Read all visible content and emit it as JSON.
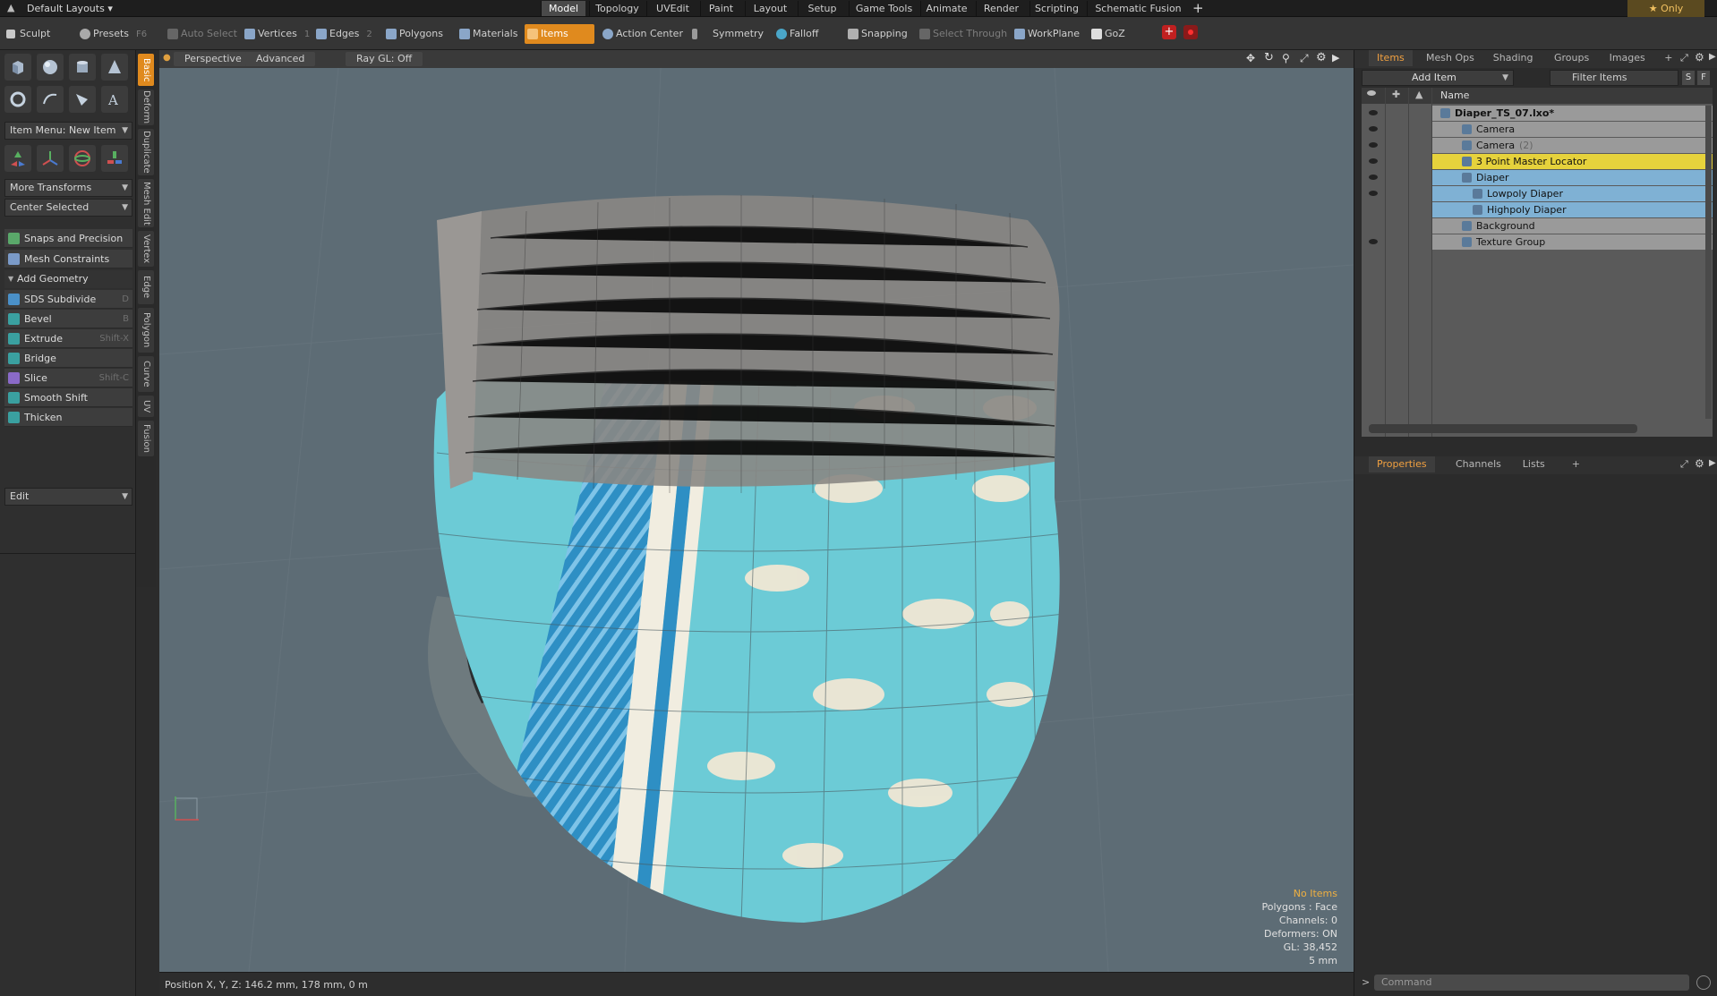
{
  "menubar": {
    "layouts": "Default Layouts",
    "tabs": [
      "Model",
      "Topology",
      "UVEdit",
      "Paint",
      "Layout",
      "Setup",
      "Game Tools",
      "Animate",
      "Render",
      "Scripting",
      "Schematic Fusion"
    ],
    "active_tab": "Model",
    "add": "+",
    "only": "Only"
  },
  "toolbar": {
    "sculpt": "Sculpt",
    "presets": "Presets",
    "presets_hotkey": "F6",
    "auto_select": "Auto Select",
    "vertices": "Vertices",
    "vertices_hotkey": "1",
    "edges": "Edges",
    "edges_hotkey": "2",
    "polygons": "Polygons",
    "materials": "Materials",
    "items": "Items",
    "action_center": "Action Center",
    "symmetry": "Symmetry",
    "falloff": "Falloff",
    "snapping": "Snapping",
    "select_through": "Select Through",
    "workplane": "WorkPlane",
    "goz": "GoZ"
  },
  "leftpanel": {
    "item_menu": "Item Menu: New Item",
    "more_transforms": "More Transforms",
    "center_selected": "Center Selected",
    "snaps": "Snaps and Precision",
    "mesh_constraints": "Mesh Constraints",
    "add_geometry": "Add Geometry",
    "tools": [
      {
        "label": "SDS Subdivide",
        "hotkey": "D",
        "color": "#4a90c8"
      },
      {
        "label": "Bevel",
        "hotkey": "B",
        "color": "#3aa0a0"
      },
      {
        "label": "Extrude",
        "hotkey": "Shift-X",
        "color": "#3aa0a0"
      },
      {
        "label": "Bridge",
        "hotkey": "",
        "color": "#3aa0a0"
      },
      {
        "label": "Slice",
        "hotkey": "Shift-C",
        "color": "#8a6ac8"
      },
      {
        "label": "Smooth Shift",
        "hotkey": "",
        "color": "#3aa0a0"
      },
      {
        "label": "Thicken",
        "hotkey": "",
        "color": "#3aa0a0"
      }
    ],
    "edit": "Edit"
  },
  "vtabs": [
    "Basic",
    "Deform",
    "Duplicate",
    "Mesh Edit",
    "Vertex",
    "Edge",
    "Polygon",
    "Curve",
    "UV",
    "Fusion"
  ],
  "viewport": {
    "perspective": "Perspective",
    "advanced": "Advanced",
    "raygl": "Ray GL: Off",
    "hud": {
      "no_items": "No Items",
      "polygons": "Polygons : Face",
      "channels": "Channels: 0",
      "deformers": "Deformers: ON",
      "gl": "GL: 38,452",
      "scale": "5 mm"
    }
  },
  "status": {
    "position": "Position X, Y, Z:   146.2 mm, 178 mm, 0 m"
  },
  "rightpanel": {
    "tabs": [
      "Items",
      "Mesh Ops",
      "Shading",
      "Groups",
      "Images",
      "+"
    ],
    "add_item": "Add Item",
    "filter": "Filter Items",
    "filter_s": "S",
    "filter_f": "F",
    "name_header": "Name",
    "tree": [
      {
        "label": "Diaper_TS_07.lxo*",
        "indent": 0,
        "style": "norm",
        "eye": true
      },
      {
        "label": "Camera",
        "indent": 2,
        "style": "norm",
        "eye": true
      },
      {
        "label": "Camera",
        "suffix": "(2)",
        "indent": 2,
        "style": "norm",
        "eye": true
      },
      {
        "label": "3 Point Master Locator",
        "indent": 2,
        "style": "hl",
        "eye": true
      },
      {
        "label": "Diaper",
        "indent": 2,
        "style": "sel",
        "eye": true
      },
      {
        "label": "Lowpoly Diaper",
        "indent": 3,
        "style": "sel",
        "eye": true
      },
      {
        "label": "Highpoly Diaper",
        "indent": 3,
        "style": "sel",
        "eye": false
      },
      {
        "label": "Background",
        "indent": 2,
        "style": "norm",
        "eye": false
      },
      {
        "label": "Texture Group",
        "indent": 2,
        "style": "norm",
        "eye": true
      }
    ],
    "bottom_tabs": [
      "Properties",
      "Channels",
      "Lists",
      "+"
    ],
    "command": "Command"
  }
}
